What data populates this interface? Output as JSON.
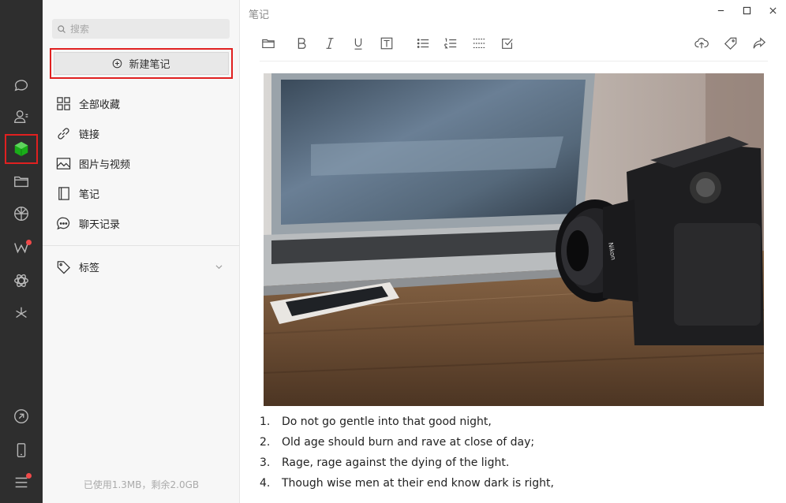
{
  "sidebar_rail": {
    "icons": [
      "chat-icon",
      "contacts-icon",
      "favorites-cube-icon",
      "folder-icon",
      "moments-icon",
      "channels-icon",
      "mini-program-icon",
      "discover-icon",
      "link-icon",
      "phone-icon",
      "menu-icon"
    ],
    "active": "favorites-cube-icon",
    "accent_color": "#1aad19",
    "badge_color": "#f04a4a"
  },
  "middle_panel": {
    "search_placeholder": "搜索",
    "new_note_label": "新建笔记",
    "menu_items": [
      {
        "label": "全部收藏",
        "icon": "grid-icon"
      },
      {
        "label": "链接",
        "icon": "link-icon"
      },
      {
        "label": "图片与视频",
        "icon": "image-icon"
      },
      {
        "label": "笔记",
        "icon": "notebook-icon"
      },
      {
        "label": "聊天记录",
        "icon": "chat-record-icon"
      }
    ],
    "tags_label": "标签",
    "usage_text": "已使用1.3MB，剩余2.0GB"
  },
  "editor": {
    "window_title": "笔记",
    "toolbar": [
      "folder-icon",
      "bold-icon",
      "italic-icon",
      "underline-icon",
      "text-icon",
      "bullet-list-icon",
      "numbered-list-icon",
      "divider-icon",
      "checkbox-icon",
      "upload-cloud-icon",
      "tag-icon",
      "share-icon"
    ],
    "image": "photo of laptop, smartphone and Nikon camera on wooden table",
    "list": [
      {
        "num": "1.",
        "text": "Do not go gentle into that good night,"
      },
      {
        "num": "2.",
        "text": "Old age should burn and rave at close of day;"
      },
      {
        "num": "3.",
        "text": "Rage, rage against the dying of the light."
      },
      {
        "num": "4.",
        "text": "Though wise men at their end know dark is right,"
      }
    ]
  }
}
